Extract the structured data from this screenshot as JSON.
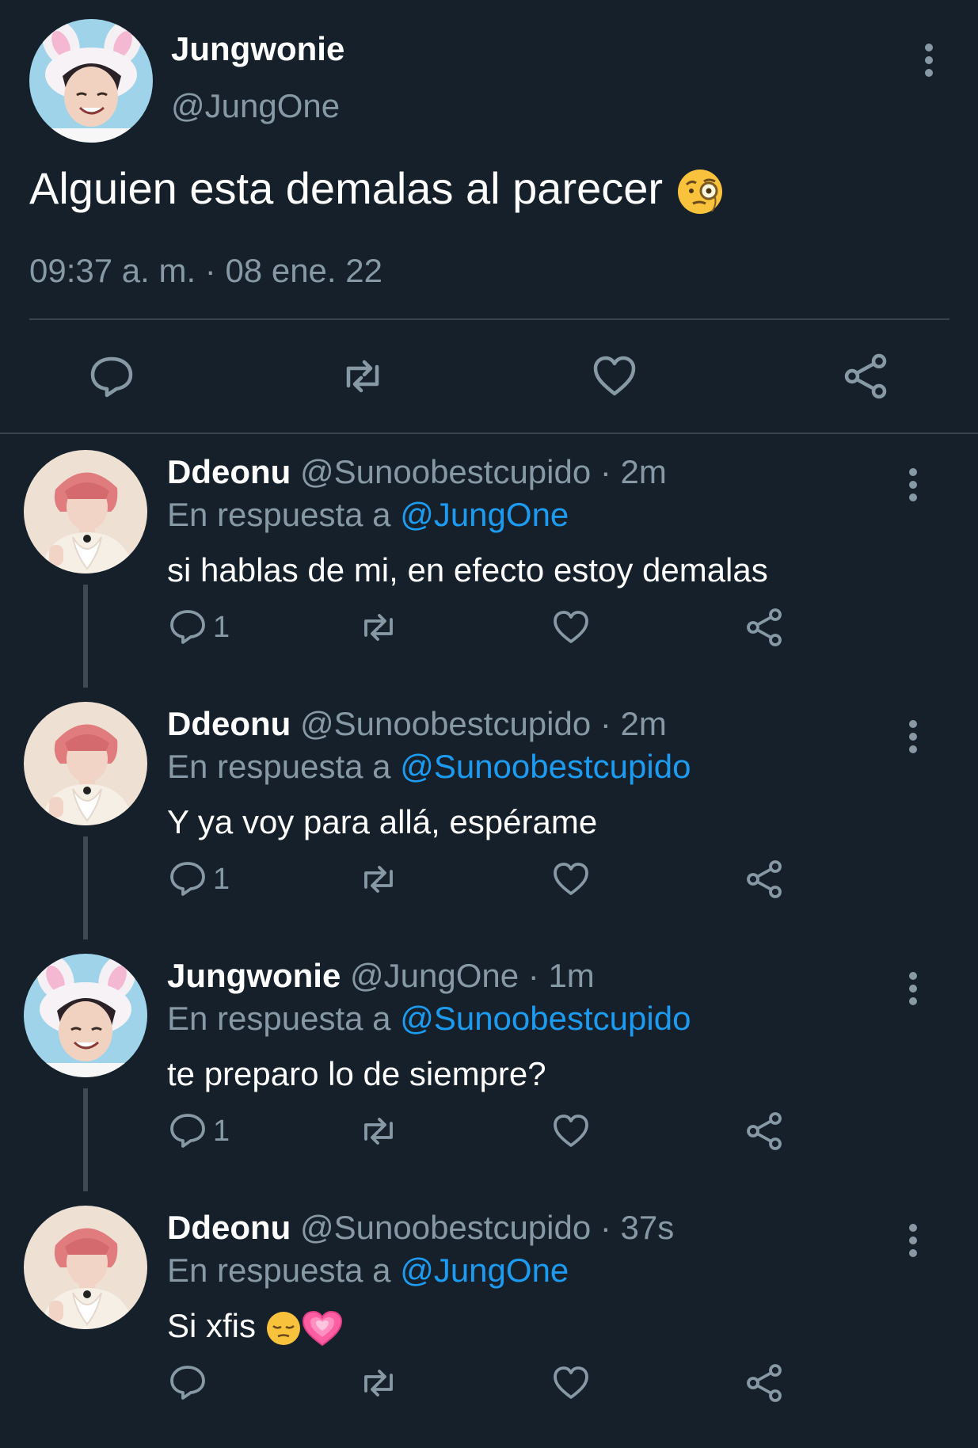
{
  "main_tweet": {
    "author_name": "Jungwonie",
    "author_handle": "@JungOne",
    "text": "Alguien esta demalas al parecer",
    "text_emoji": "monocle-face-emoji",
    "timestamp": "09:37 a. m. · 08 ene. 22",
    "actions": [
      "reply-icon",
      "retweet-icon",
      "like-icon",
      "share-icon"
    ]
  },
  "replies": [
    {
      "name": "Ddeonu",
      "handle": "@Sunoobestcupido",
      "time": "· 2m",
      "reply_prefix": "En respuesta a",
      "reply_to": "@JungOne",
      "text": "si hablas de mi, en efecto estoy demalas",
      "reply_count": "1",
      "avatar": "ddeonu-avatar"
    },
    {
      "name": "Ddeonu",
      "handle": "@Sunoobestcupido",
      "time": "· 2m",
      "reply_prefix": "En respuesta a",
      "reply_to": "@Sunoobestcupido",
      "text": "Y ya voy para allá, espérame",
      "reply_count": "1",
      "avatar": "ddeonu-avatar"
    },
    {
      "name": "Jungwonie",
      "handle": "@JungOne",
      "time": "· 1m",
      "reply_prefix": "En respuesta a",
      "reply_to": "@Sunoobestcupido",
      "text": "te preparo lo de siempre?",
      "reply_count": "1",
      "avatar": "jungwonie-avatar"
    },
    {
      "name": "Ddeonu",
      "handle": "@Sunoobestcupido",
      "time": "· 37s",
      "reply_prefix": "En respuesta a",
      "reply_to": "@JungOne",
      "text": "Si xfis",
      "text_emojis": [
        "pensive-face-emoji",
        "growing-heart-emoji"
      ],
      "reply_count": "",
      "avatar": "ddeonu-avatar"
    }
  ],
  "colors": {
    "background": "#15202b",
    "text": "#ffffff",
    "muted": "#8899a6",
    "link": "#1d9bf0",
    "divider": "#38444d"
  }
}
